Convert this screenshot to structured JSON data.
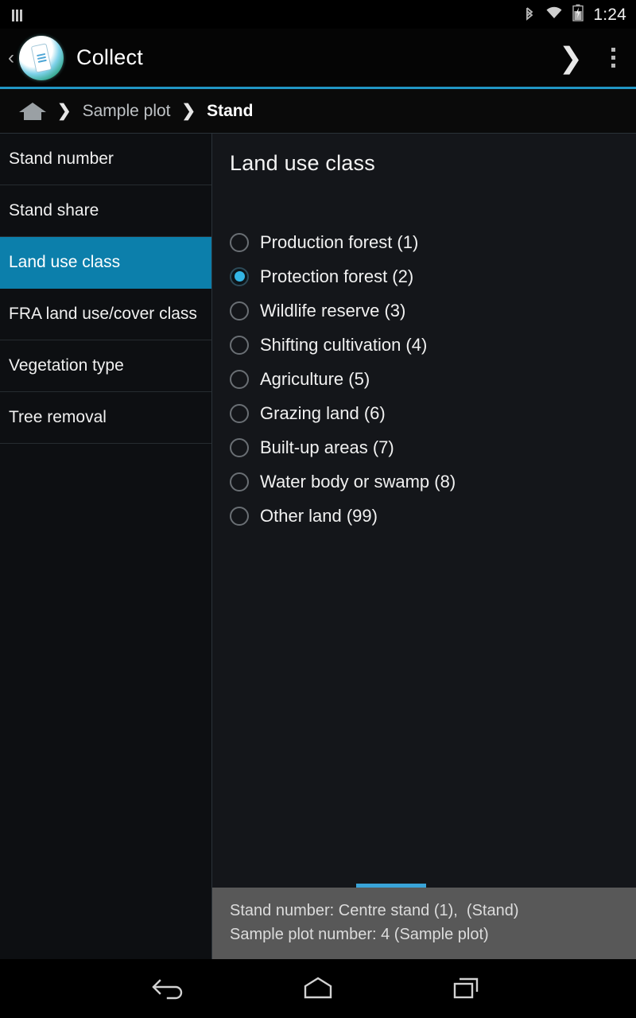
{
  "statusbar": {
    "notification_icon": "bars-icon",
    "bluetooth_icon": "bluetooth-icon",
    "wifi_icon": "wifi-icon",
    "battery_icon": "battery-charging-icon",
    "time": "1:24"
  },
  "actionbar": {
    "up_caret": "‹",
    "logo_icon": "collect-app-logo",
    "title": "Collect",
    "next_caret": "❯",
    "overflow_icon": "overflow-menu-icon",
    "accent_color": "#2196c4"
  },
  "breadcrumb": {
    "home_icon": "home-icon",
    "separator": "❯",
    "items": [
      {
        "label": "Sample plot",
        "current": false
      },
      {
        "label": "Stand",
        "current": true
      }
    ]
  },
  "sidebar": {
    "selected_color": "#0c7fab",
    "items": [
      {
        "label": "Stand number",
        "selected": false
      },
      {
        "label": "Stand share",
        "selected": false
      },
      {
        "label": "Land use class",
        "selected": true
      },
      {
        "label": "FRA land use/cover class",
        "selected": false
      },
      {
        "label": "Vegetation type",
        "selected": false
      },
      {
        "label": "Tree removal",
        "selected": false
      }
    ]
  },
  "main": {
    "title": "Land use class",
    "accent_color": "#33b5e5",
    "options": [
      {
        "label": "Production forest (1)",
        "checked": false
      },
      {
        "label": "Protection forest (2)",
        "checked": true
      },
      {
        "label": "Wildlife reserve (3)",
        "checked": false
      },
      {
        "label": "Shifting cultivation (4)",
        "checked": false
      },
      {
        "label": "Agriculture (5)",
        "checked": false
      },
      {
        "label": "Grazing land (6)",
        "checked": false
      },
      {
        "label": "Built-up areas (7)",
        "checked": false
      },
      {
        "label": "Water body or swamp (8)",
        "checked": false
      },
      {
        "label": "Other land (99)",
        "checked": false
      }
    ]
  },
  "info_panel": {
    "indicator_color": "#3aa4d8",
    "lines": [
      "Stand number: Centre stand (1),  (Stand)",
      "Sample plot number: 4 (Sample plot)"
    ]
  },
  "navbar": {
    "back_icon": "back-arrow-icon",
    "home_icon": "home-outline-icon",
    "recents_icon": "recent-apps-icon"
  }
}
